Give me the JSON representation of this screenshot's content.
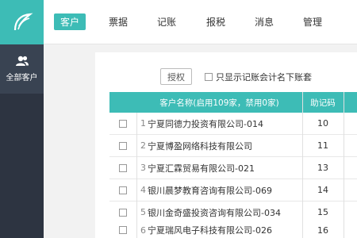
{
  "sidebar": {
    "items": [
      {
        "label": "全部客户",
        "icon": "users-icon"
      }
    ]
  },
  "nav": [
    {
      "label": "客户",
      "active": true
    },
    {
      "label": "票据"
    },
    {
      "label": "记账"
    },
    {
      "label": "报税"
    },
    {
      "label": "消息"
    },
    {
      "label": "管理"
    }
  ],
  "toolbar": {
    "authorize_label": "授权",
    "filter_label": "只显示记账会计名下账套"
  },
  "table": {
    "headers": {
      "name": "客户名称(启用109家，禁用0家)",
      "code": "助记码"
    },
    "rows": [
      {
        "index": "1",
        "name": "宁夏同德力投资有限公司-014",
        "code": "10"
      },
      {
        "index": "2",
        "name": "宁夏博盈网络科技有限公司",
        "code": "11"
      },
      {
        "index": "3",
        "name": "宁夏汇霖贸易有限公司-021",
        "code": "13"
      },
      {
        "index": "4",
        "name": "银川晨梦教育咨询有限公司-069",
        "code": "14"
      },
      {
        "index": "5",
        "name": "银川金奇盛投资咨询有限公司-034",
        "code": "15"
      },
      {
        "index": "6",
        "name": "宁夏瑞风电子科技有限公司-026",
        "code": "16"
      }
    ]
  },
  "colors": {
    "accent": "#3dbcb6",
    "sidebar": "#2d3441"
  }
}
